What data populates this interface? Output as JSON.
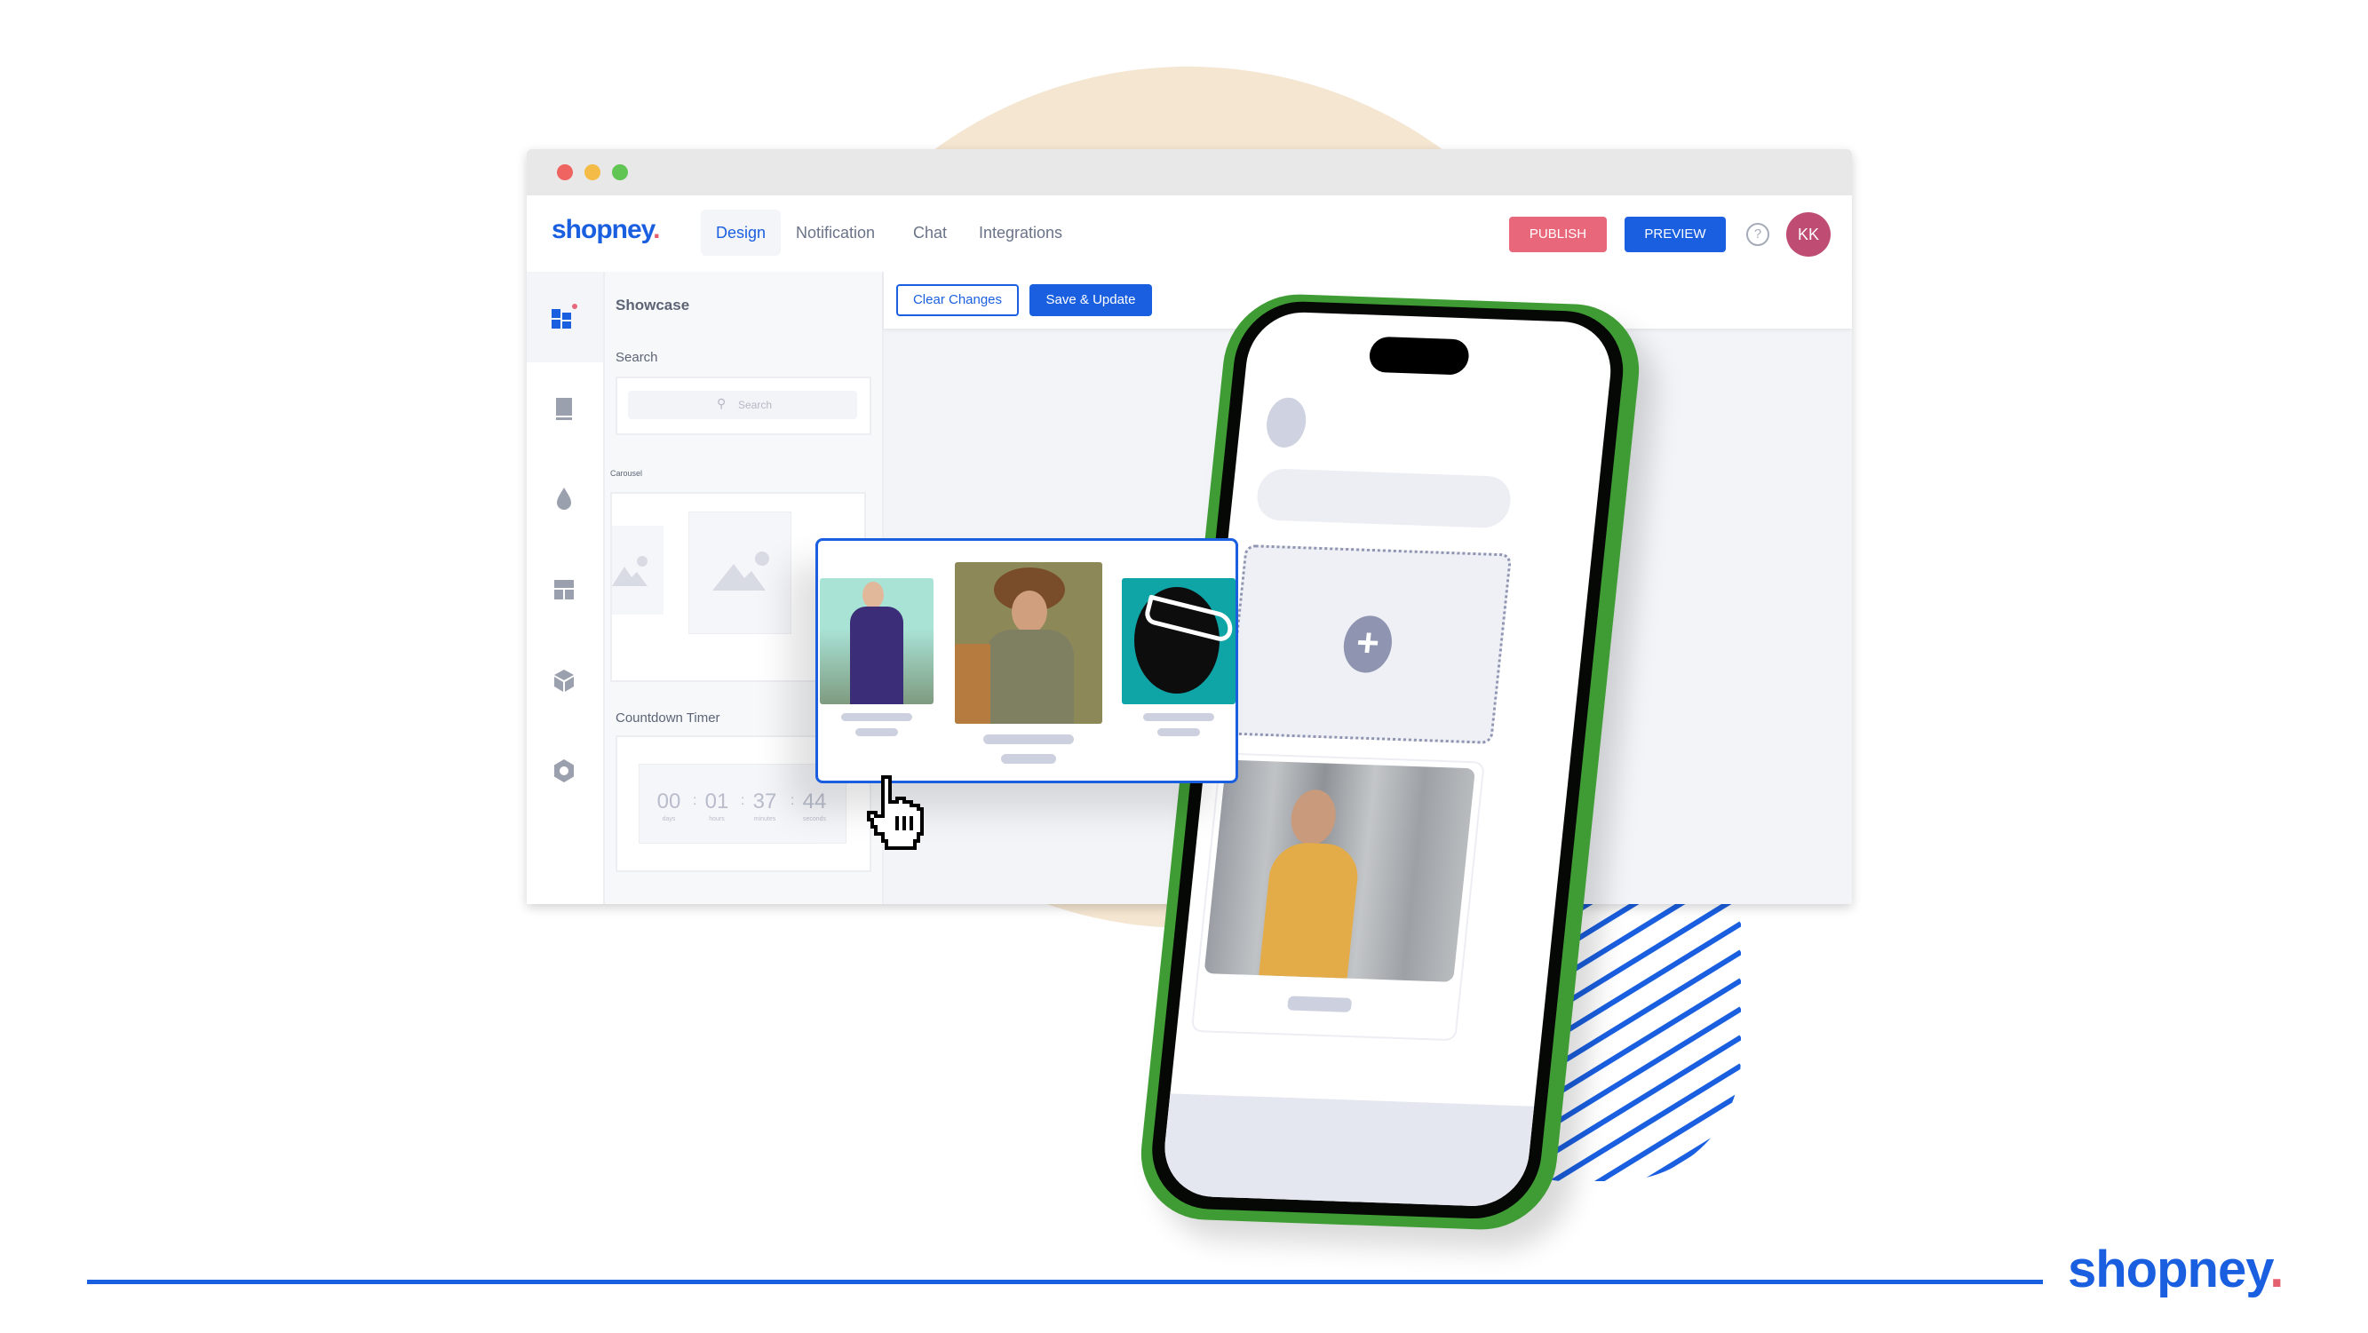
{
  "window": {
    "traffic_lights": {
      "close": "#ef6461",
      "minimize": "#f4bb46",
      "maximize": "#61c554"
    }
  },
  "header": {
    "logo_text": "shopney",
    "logo_dot": ".",
    "tabs": [
      {
        "label": "Design",
        "active": true
      },
      {
        "label": "Notification",
        "active": false
      },
      {
        "label": "Chat",
        "active": false
      },
      {
        "label": "Integrations",
        "active": false
      }
    ],
    "publish_label": "PUBLISH",
    "preview_label": "PREVIEW",
    "help_icon": "?",
    "avatar_initials": "KK"
  },
  "rail": {
    "items": [
      {
        "icon": "dashboard-icon",
        "active": true,
        "notification": true
      },
      {
        "icon": "page-icon",
        "active": false
      },
      {
        "icon": "drop-icon",
        "active": false
      },
      {
        "icon": "layout-icon",
        "active": false
      },
      {
        "icon": "cube-icon",
        "active": false
      },
      {
        "icon": "hexagon-icon",
        "active": false
      }
    ]
  },
  "panel": {
    "title": "Showcase",
    "search_label": "Search",
    "search_placeholder": "Search",
    "carousel_label": "Carousel",
    "countdown_label": "Countdown Timer",
    "countdown": [
      {
        "value": "00",
        "unit": "days"
      },
      {
        "value": "01",
        "unit": "hours"
      },
      {
        "value": "37",
        "unit": "minutes"
      },
      {
        "value": "44",
        "unit": "seconds"
      }
    ],
    "separator": ":"
  },
  "toolbar": {
    "clear_label": "Clear Changes",
    "save_label": "Save & Update"
  },
  "carousel_preview": {
    "products": [
      {
        "image": "woman-purple-lace-dress",
        "colors": [
          "#a9e3d6",
          "#3b2d78"
        ]
      },
      {
        "image": "woman-hat-olive-shirt",
        "colors": [
          "#8c8858",
          "#7c7a5f"
        ]
      },
      {
        "image": "man-white-sunglasses",
        "colors": [
          "#0fa5a7",
          "#0d0d0d"
        ]
      }
    ]
  },
  "phone": {
    "add_icon": "+",
    "featured_image": "woman-yellow-wrap-dress"
  },
  "footer": {
    "logo_text": "shopney",
    "logo_dot": "."
  },
  "colors": {
    "brand_blue": "#1a5fe0",
    "publish_red": "#e8677a",
    "avatar": "#bf4c72",
    "beige": "#f4e6d1",
    "phone_green": "#3f9c34"
  }
}
